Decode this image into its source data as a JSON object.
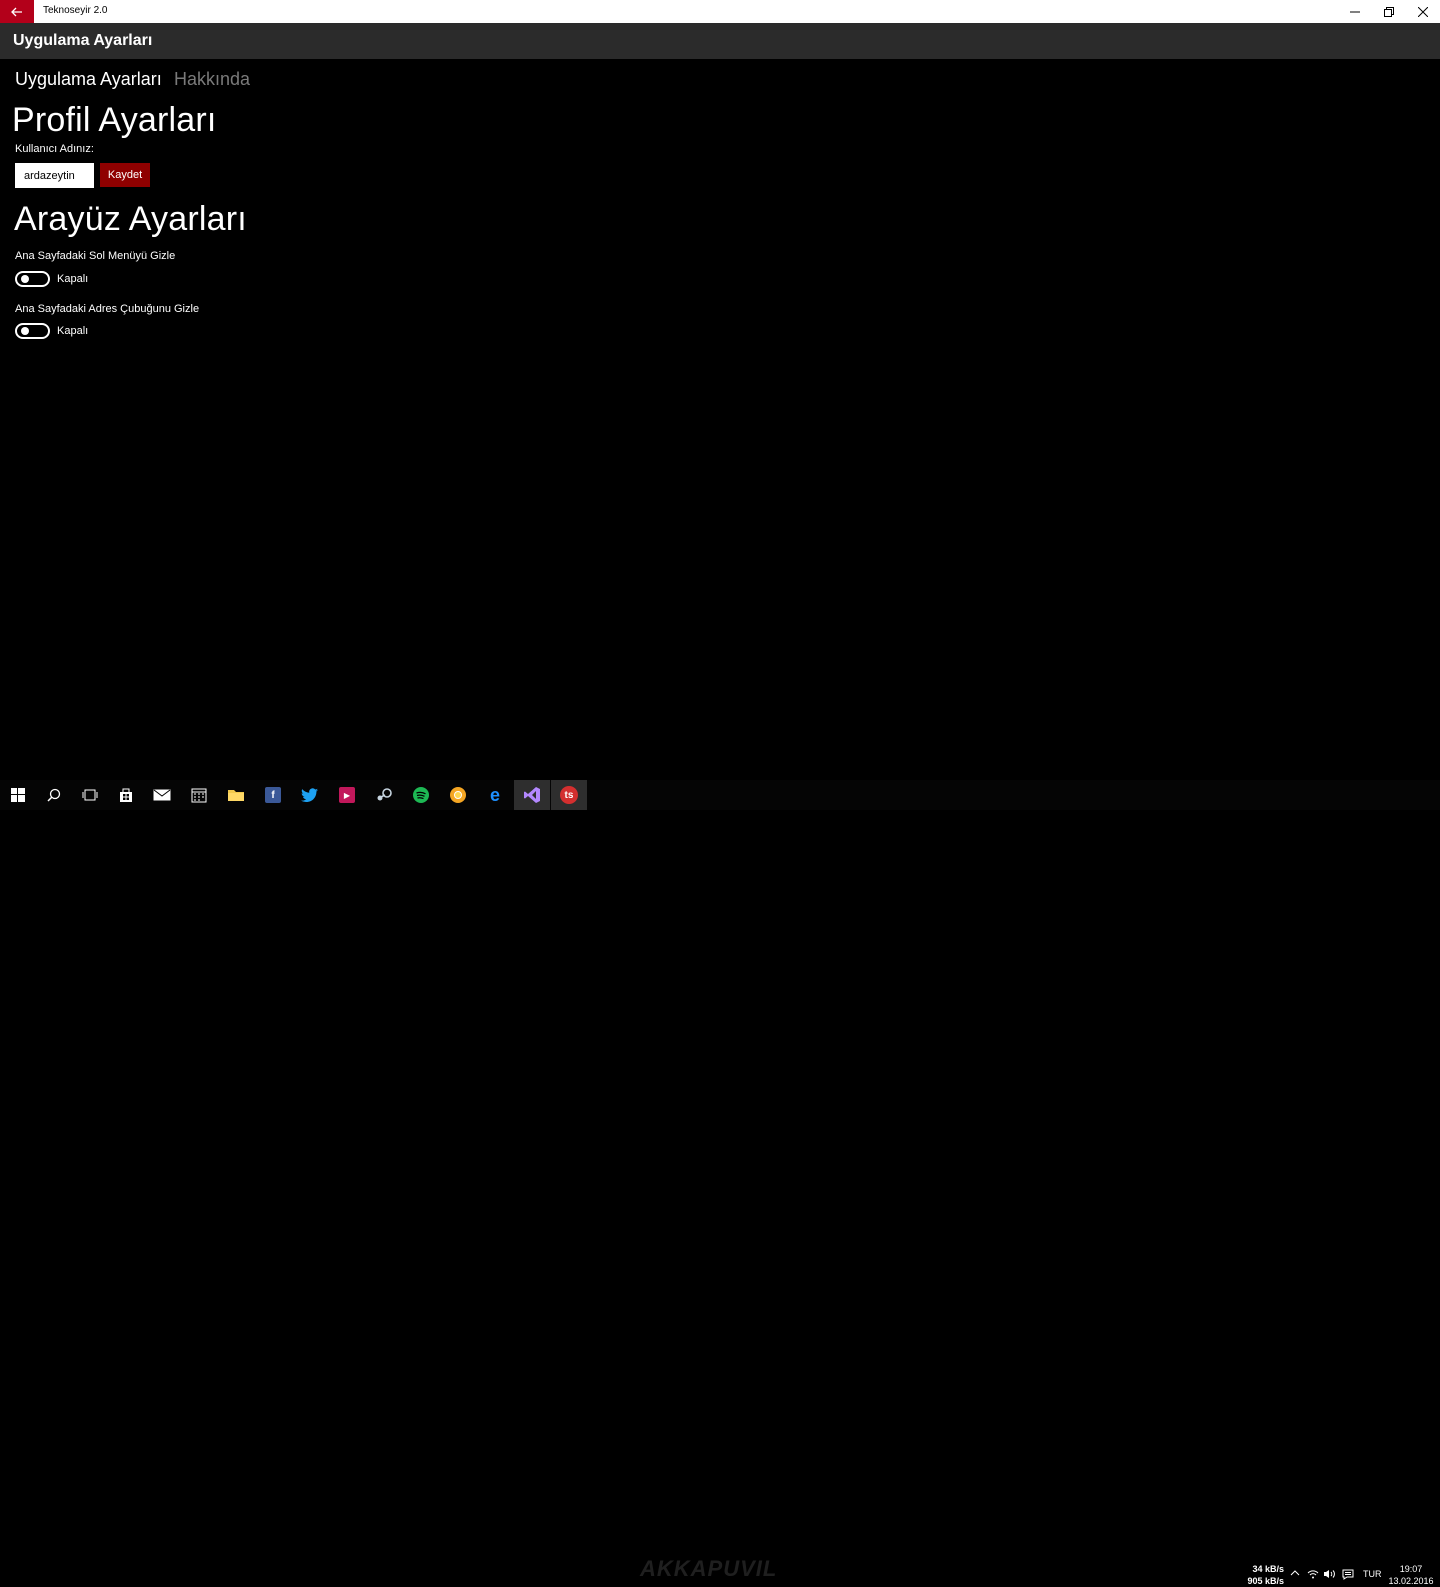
{
  "window": {
    "app_title": "Teknoseyir 2.0",
    "back_icon": "arrow-left-icon"
  },
  "header": {
    "title": "Uygulama Ayarları"
  },
  "tabs": [
    {
      "label": "Uygulama Ayarları",
      "active": true
    },
    {
      "label": "Hakkında",
      "active": false
    }
  ],
  "profile": {
    "heading": "Profil Ayarları",
    "username_label": "Kullanıcı Adınız:",
    "username_value": "ardazeytin",
    "save_label": "Kaydet"
  },
  "interface": {
    "heading": "Arayüz Ayarları",
    "toggles": [
      {
        "label": "Ana Sayfadaki Sol Menüyü Gizle",
        "state": "Kapalı",
        "on": false
      },
      {
        "label": "Ana Sayfadaki Adres Çubuğunu Gizle",
        "state": "Kapalı",
        "on": false
      }
    ]
  },
  "taskbar": {
    "watermark": "AKKAPUVIL",
    "network": {
      "up": "34 kB/s",
      "down": "905 kB/s"
    },
    "language": "TUR",
    "time": "19:07",
    "date": "13.02.2016"
  },
  "colors": {
    "accent": "#b3001a",
    "save_button": "#8f0000",
    "header_bg": "#2b2b2b"
  }
}
